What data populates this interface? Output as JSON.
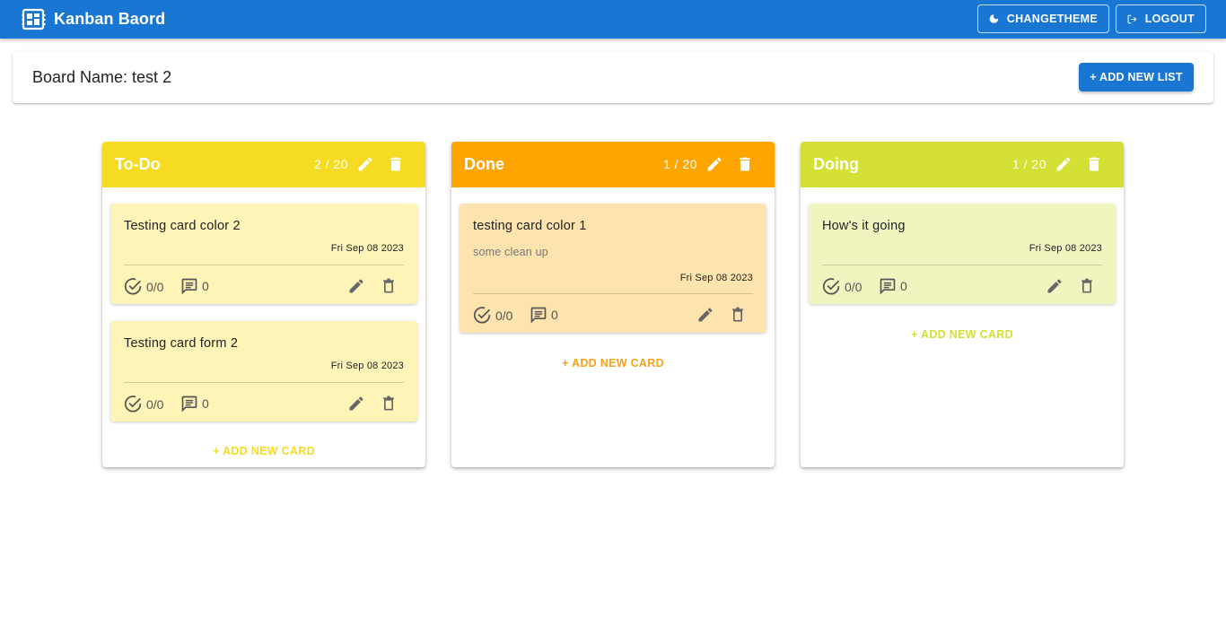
{
  "app": {
    "title": "Kanban Baord"
  },
  "header": {
    "theme_label": "CHANGETHEME",
    "logout_label": "LOGOUT"
  },
  "board": {
    "name_label": "Board Name: test 2",
    "add_list_label": "+ ADD NEW LIST"
  },
  "icons": {
    "logo": "dashboard-icon",
    "theme": "moon-icon",
    "logout": "logout-icon",
    "edit": "pencil-icon",
    "delete": "trash-icon",
    "checklist": "check-circle-icon",
    "comments": "comment-icon"
  },
  "colors": {
    "primary": "#1976d2",
    "todo": "#f5dc22",
    "done": "#ffa500",
    "doing": "#d4e033",
    "todo_card": "#fef4b8",
    "done_card": "#fde3ae",
    "doing_card": "#f0f5c0"
  },
  "lists": [
    {
      "title": "To-Do",
      "count": "2 / 20",
      "add_card_label": "+ ADD NEW CARD",
      "cards": [
        {
          "title": "Testing card color 2",
          "description": "",
          "date": "Fri Sep 08 2023",
          "checklist": "0/0",
          "comments": "0"
        },
        {
          "title": "Testing card form 2",
          "description": "",
          "date": "Fri Sep 08 2023",
          "checklist": "0/0",
          "comments": "0"
        }
      ]
    },
    {
      "title": "Done",
      "count": "1 / 20",
      "add_card_label": "+ ADD NEW CARD",
      "cards": [
        {
          "title": "testing card color 1",
          "description": "some clean up",
          "date": "Fri Sep 08 2023",
          "checklist": "0/0",
          "comments": "0"
        }
      ]
    },
    {
      "title": "Doing",
      "count": "1 / 20",
      "add_card_label": "+ ADD NEW CARD",
      "cards": [
        {
          "title": "How's it going",
          "description": "",
          "date": "Fri Sep 08 2023",
          "checklist": "0/0",
          "comments": "0"
        }
      ]
    }
  ]
}
